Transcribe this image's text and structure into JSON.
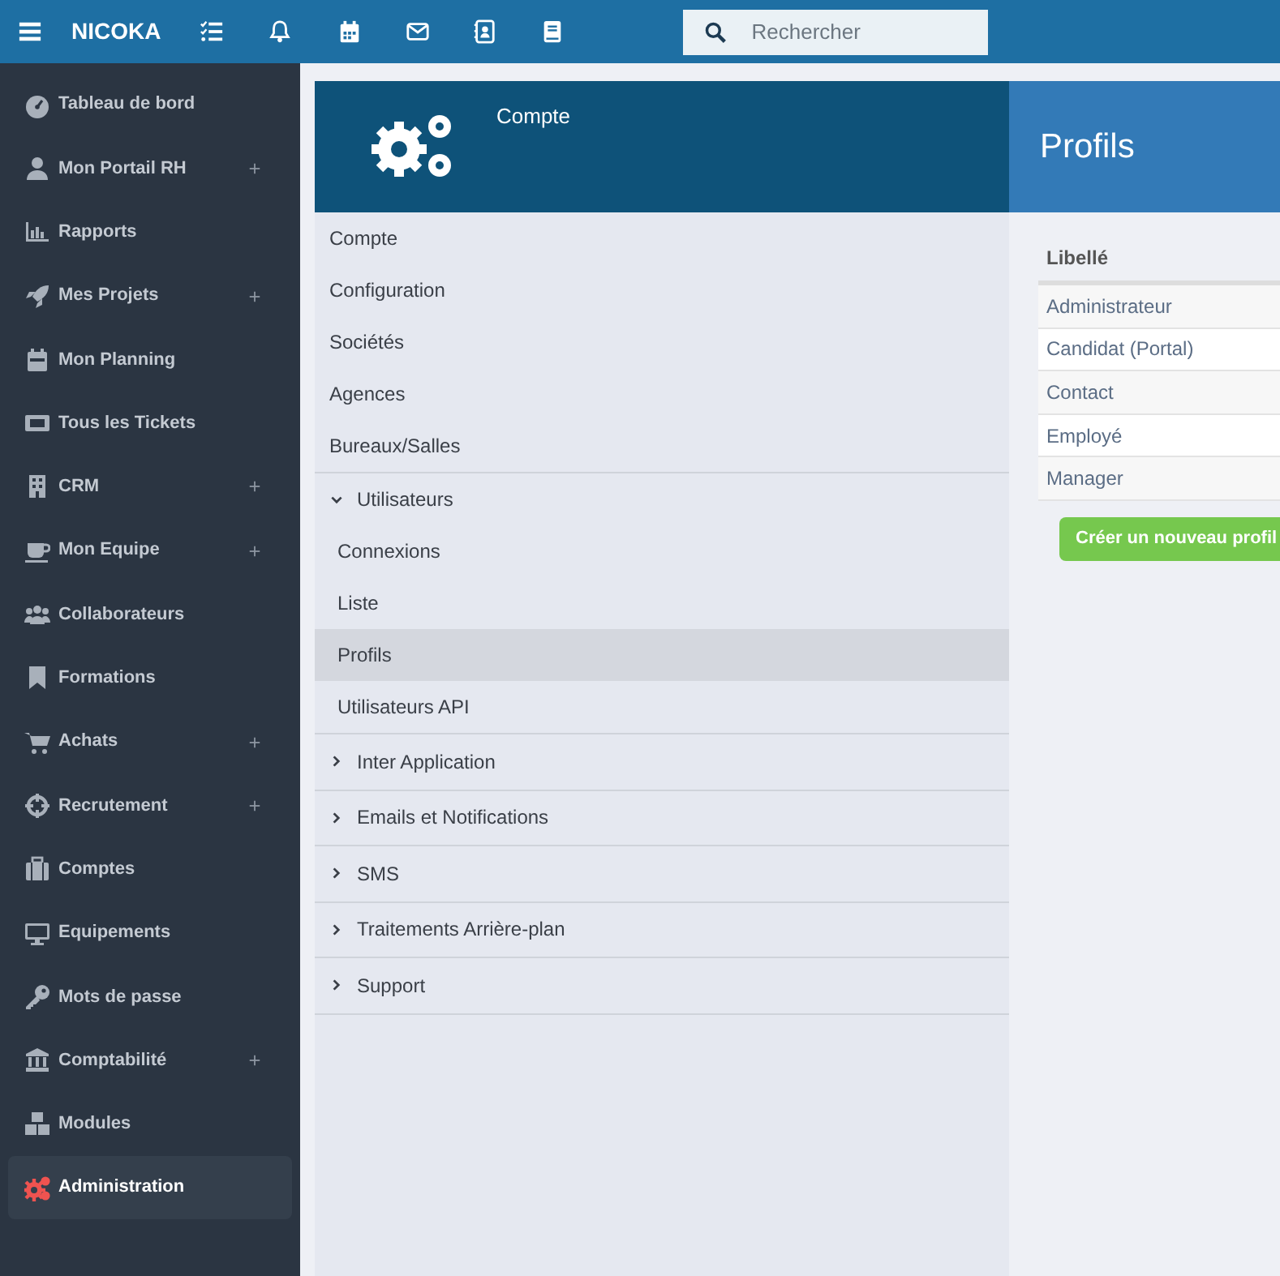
{
  "top_bar": {
    "brand": "NICOKA",
    "search": {
      "placeholder": "Rechercher"
    }
  },
  "sidebar": {
    "items": [
      {
        "label": "Tableau de bord",
        "expandable": false,
        "selected": false
      },
      {
        "label": "Mon Portail RH",
        "expandable": true,
        "selected": false
      },
      {
        "label": "Rapports",
        "expandable": false,
        "selected": false
      },
      {
        "label": "Mes Projets",
        "expandable": true,
        "selected": false
      },
      {
        "label": "Mon Planning",
        "expandable": false,
        "selected": false
      },
      {
        "label": "Tous les Tickets",
        "expandable": false,
        "selected": false
      },
      {
        "label": "CRM",
        "expandable": true,
        "selected": false
      },
      {
        "label": "Mon Equipe",
        "expandable": true,
        "selected": false
      },
      {
        "label": "Collaborateurs",
        "expandable": false,
        "selected": false
      },
      {
        "label": "Formations",
        "expandable": false,
        "selected": false
      },
      {
        "label": "Achats",
        "expandable": true,
        "selected": false
      },
      {
        "label": "Recrutement",
        "expandable": true,
        "selected": false
      },
      {
        "label": "Comptes",
        "expandable": false,
        "selected": false
      },
      {
        "label": "Equipements",
        "expandable": false,
        "selected": false
      },
      {
        "label": "Mots de passe",
        "expandable": false,
        "selected": false
      },
      {
        "label": "Comptabilité",
        "expandable": true,
        "selected": false
      },
      {
        "label": "Modules",
        "expandable": false,
        "selected": false
      },
      {
        "label": "Administration",
        "expandable": false,
        "selected": true
      }
    ]
  },
  "settings_panel": {
    "title": "Compte",
    "menu": [
      {
        "kind": "link",
        "label": "Compte",
        "selected": false
      },
      {
        "kind": "link",
        "label": "Configuration",
        "selected": false
      },
      {
        "kind": "link",
        "label": "Sociétés",
        "selected": false
      },
      {
        "kind": "link",
        "label": "Agences",
        "selected": false
      },
      {
        "kind": "link",
        "label": "Bureaux/Salles",
        "selected": false
      },
      {
        "kind": "group",
        "label": "Utilisateurs",
        "expanded": true,
        "children": [
          {
            "label": "Connexions",
            "selected": false
          },
          {
            "label": "Liste",
            "selected": false
          },
          {
            "label": "Profils",
            "selected": true
          },
          {
            "label": "Utilisateurs API",
            "selected": false
          }
        ]
      },
      {
        "kind": "group",
        "label": "Inter Application",
        "expanded": false
      },
      {
        "kind": "group",
        "label": "Emails et Notifications",
        "expanded": false
      },
      {
        "kind": "group",
        "label": "SMS",
        "expanded": false
      },
      {
        "kind": "group",
        "label": "Traitements Arrière-plan",
        "expanded": false
      },
      {
        "kind": "group",
        "label": "Support",
        "expanded": false
      }
    ]
  },
  "content": {
    "title": "Profils",
    "table": {
      "columns": [
        "Libellé"
      ],
      "rows": [
        [
          "Administrateur"
        ],
        [
          "Candidat (Portal)"
        ],
        [
          "Contact"
        ],
        [
          "Employé"
        ],
        [
          "Manager"
        ]
      ]
    },
    "create_button": "Créer un nouveau profil"
  }
}
